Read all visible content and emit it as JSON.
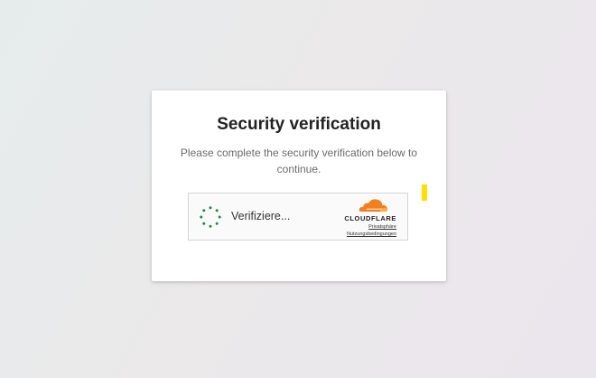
{
  "card": {
    "title": "Security verification",
    "subtitle": "Please complete the security verification below to continue."
  },
  "widget": {
    "status_text": "Verifiziere...",
    "spinner_icon": "loading-spinner-icon",
    "brand": {
      "logo_icon": "cloudflare-cloud-icon",
      "wordmark": "CLOUDFLARE",
      "privacy_link": "Privatsphäre",
      "terms_link": "Nutzungsbedingungen"
    }
  },
  "colors": {
    "spinner": "#1f8a4c",
    "cloudflare_orange": "#f38020",
    "cloudflare_light": "#faae40",
    "marker": "#ffe100"
  }
}
